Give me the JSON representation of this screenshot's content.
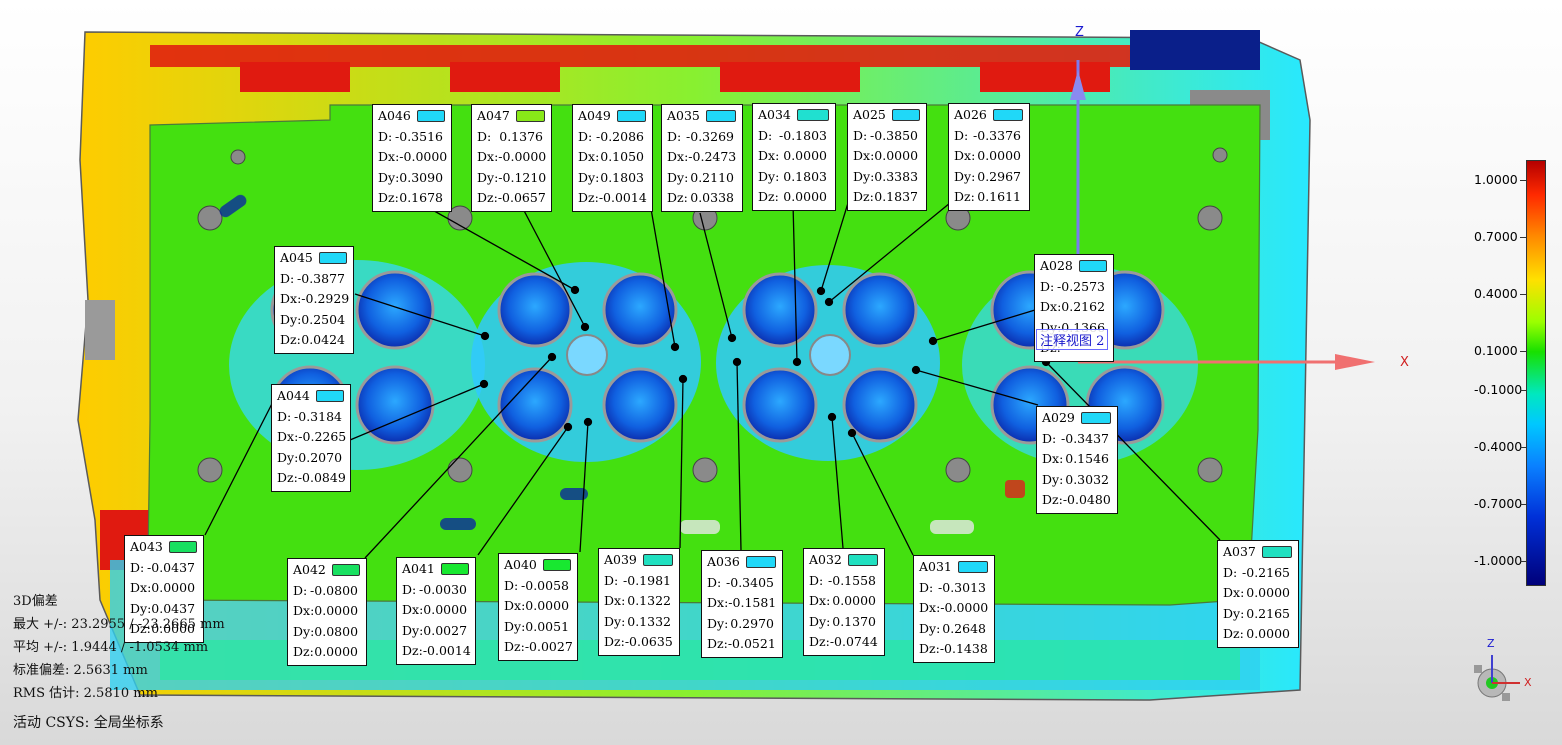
{
  "annotations": [
    {
      "id": "A046",
      "color": "#20d8f8",
      "D": "-0.3516",
      "Dx": "-0.0000",
      "Dy": "0.3090",
      "Dz": "0.1678"
    },
    {
      "id": "A047",
      "color": "#88e818",
      "D": "0.1376",
      "Dx": "-0.0000",
      "Dy": "-0.1210",
      "Dz": "-0.0657"
    },
    {
      "id": "A049",
      "color": "#20d8f8",
      "D": "-0.2086",
      "Dx": "0.1050",
      "Dy": "0.1803",
      "Dz": "-0.0014"
    },
    {
      "id": "A035",
      "color": "#20d8f8",
      "D": "-0.3269",
      "Dx": "-0.2473",
      "Dy": "0.2110",
      "Dz": "0.0338"
    },
    {
      "id": "A034",
      "color": "#20e0d0",
      "D": "-0.1803",
      "Dx": "0.0000",
      "Dy": "0.1803",
      "Dz": "0.0000"
    },
    {
      "id": "A025",
      "color": "#20d8f8",
      "D": "-0.3850",
      "Dx": "0.0000",
      "Dy": "0.3383",
      "Dz": "0.1837"
    },
    {
      "id": "A026",
      "color": "#20d8f8",
      "D": "-0.3376",
      "Dx": "0.0000",
      "Dy": "0.2967",
      "Dz": "0.1611"
    },
    {
      "id": "A045",
      "color": "#20d8f8",
      "D": "-0.3877",
      "Dx": "-0.2929",
      "Dy": "0.2504",
      "Dz": "0.0424"
    },
    {
      "id": "A028",
      "color": "#20d8f8",
      "D": "-0.2573",
      "Dx": "0.2162",
      "Dy": "0.1366",
      "Dz": ""
    },
    {
      "id": "A044",
      "color": "#20d8f8",
      "D": "-0.3184",
      "Dx": "-0.2265",
      "Dy": "0.2070",
      "Dz": "-0.0849"
    },
    {
      "id": "A029",
      "color": "#20d8f8",
      "D": "-0.3437",
      "Dx": "0.1546",
      "Dy": "0.3032",
      "Dz": "-0.0480"
    },
    {
      "id": "A043",
      "color": "#18e060",
      "D": "-0.0437",
      "Dx": "0.0000",
      "Dy": "0.0437",
      "Dz": "0.0000"
    },
    {
      "id": "A042",
      "color": "#18e060",
      "D": "-0.0800",
      "Dx": "0.0000",
      "Dy": "0.0800",
      "Dz": "0.0000"
    },
    {
      "id": "A041",
      "color": "#18e830",
      "D": "-0.0030",
      "Dx": "0.0000",
      "Dy": "0.0027",
      "Dz": "-0.0014"
    },
    {
      "id": "A040",
      "color": "#18e830",
      "D": "-0.0058",
      "Dx": "0.0000",
      "Dy": "0.0051",
      "Dz": "-0.0027"
    },
    {
      "id": "A039",
      "color": "#20e0c0",
      "D": "-0.1981",
      "Dx": "0.1322",
      "Dy": "0.1332",
      "Dz": "-0.0635"
    },
    {
      "id": "A036",
      "color": "#20d8f8",
      "D": "-0.3405",
      "Dx": "-0.1581",
      "Dy": "0.2970",
      "Dz": "-0.0521"
    },
    {
      "id": "A032",
      "color": "#20e0c0",
      "D": "-0.1558",
      "Dx": "0.0000",
      "Dy": "0.1370",
      "Dz": "-0.0744"
    },
    {
      "id": "A031",
      "color": "#20d8f8",
      "D": "-0.3013",
      "Dx": "-0.0000",
      "Dy": "0.2648",
      "Dz": "-0.1438"
    },
    {
      "id": "A037",
      "color": "#20e0c0",
      "D": "-0.2165",
      "Dx": "0.0000",
      "Dy": "0.2165",
      "Dz": "0.0000"
    }
  ],
  "labels": {
    "D": "D:",
    "Dx": "Dx:",
    "Dy": "Dy:",
    "Dz": "Dz:"
  },
  "legend": {
    "values": [
      "1.0000",
      "0.7000",
      "0.4000",
      "0.1000",
      "-0.1000",
      "-0.4000",
      "-0.7000",
      "-1.0000"
    ]
  },
  "stats": {
    "title": "3D偏差",
    "max": "最大 +/-: 23.2955 / -23.2665 mm",
    "mean": "平均 +/-: 1.9444 / -1.0534 mm",
    "std": "标准偏差: 2.5631 mm",
    "rms": "RMS 估计: 2.5810 mm"
  },
  "csys": "活动 CSYS: 全局坐标系",
  "axes": {
    "z": "Z",
    "x": "X"
  },
  "view_label": "注释视图 2",
  "triad": {
    "z": "Z",
    "x": "X"
  },
  "colors": {
    "part_green": "#44e010",
    "axis_blue": "#7070f0",
    "axis_red": "#f04040"
  }
}
